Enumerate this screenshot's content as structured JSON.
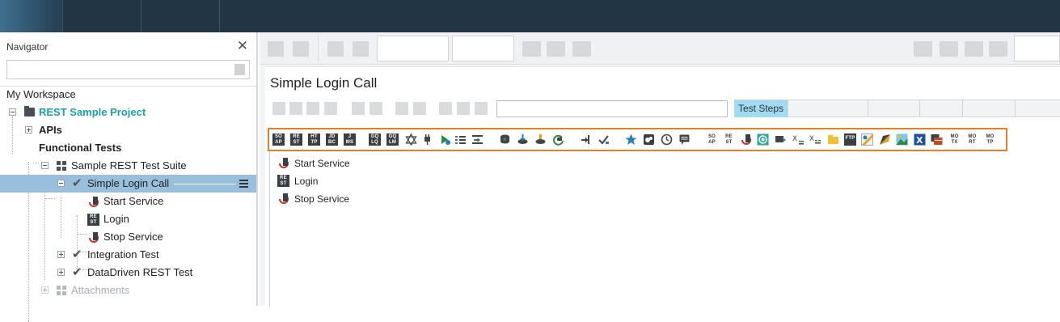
{
  "navigator": {
    "title": "Navigator",
    "search_placeholder": "",
    "workspace": "My Workspace",
    "project": "REST Sample Project",
    "apis": "APIs",
    "functional_tests": "Functional Tests",
    "suite": "Sample REST Test Suite",
    "test_case": "Simple Login Call",
    "steps": [
      "Start Service",
      "Login",
      "Stop Service"
    ],
    "other_tests": [
      "Integration Test",
      "DataDriven REST Test"
    ],
    "attachments": "Attachments"
  },
  "editor": {
    "title": "Simple Login Call",
    "tabs": [
      "Test Steps",
      "",
      "",
      "",
      "",
      ""
    ],
    "steps": [
      "Start Service",
      "Login",
      "Stop Service"
    ]
  },
  "palette_badges": {
    "soap": [
      "SO",
      "AP"
    ],
    "rest": [
      "RE",
      "ST"
    ],
    "http": [
      "HT",
      "TP"
    ],
    "jdbc": [
      "JD",
      "BC"
    ],
    "jms": [
      "J",
      "MS"
    ],
    "graphql_query": [
      "GQ",
      "LQ"
    ],
    "graphql_mutation": [
      "GQ",
      "LM"
    ],
    "mock_soap": [
      "MO",
      "TX"
    ],
    "mock_rest": [
      "MO",
      "RT"
    ],
    "mock_http": [
      "MO",
      "TP"
    ],
    "ftp": "FTP"
  },
  "colors": {
    "accent_teal": "#1a9eb0",
    "selection": "#98bfdc",
    "active_tab": "#9fdcf3",
    "palette_border": "#e87e24",
    "topbar": "#213545"
  }
}
